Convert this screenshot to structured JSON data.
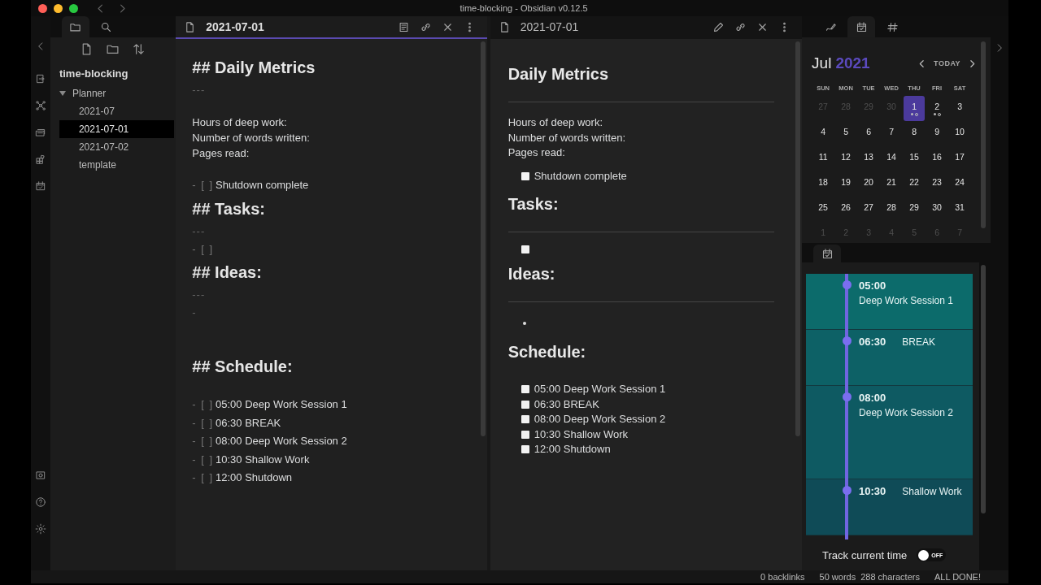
{
  "window": {
    "title": "time-blocking - Obsidian v0.12.5"
  },
  "sidebar": {
    "vault": "time-blocking",
    "tree": [
      {
        "label": "Planner",
        "expanded": true,
        "selected": false,
        "children": [
          {
            "label": "2021-07",
            "selected": false
          },
          {
            "label": "2021-07-01",
            "selected": true
          },
          {
            "label": "2021-07-02",
            "selected": false
          },
          {
            "label": "template",
            "selected": false
          }
        ]
      }
    ]
  },
  "editor": {
    "title": "2021-07-01",
    "active": true,
    "lines": [
      {
        "kind": "heading",
        "text": "## Daily Metrics"
      },
      {
        "kind": "rule",
        "text": "---"
      },
      {
        "kind": "gap"
      },
      {
        "kind": "text",
        "text": "Hours of deep work:"
      },
      {
        "kind": "text",
        "text": "Number of words written:"
      },
      {
        "kind": "text",
        "text": "Pages read:"
      },
      {
        "kind": "gap"
      },
      {
        "kind": "task",
        "marker": "- [ ]",
        "text": "Shutdown complete"
      },
      {
        "kind": "heading",
        "text": "## Tasks:"
      },
      {
        "kind": "rule",
        "text": "---"
      },
      {
        "kind": "task",
        "marker": "- [ ]"
      },
      {
        "kind": "heading",
        "text": "## Ideas:"
      },
      {
        "kind": "rule",
        "text": "---"
      },
      {
        "kind": "rule",
        "text": "-"
      },
      {
        "kind": "gap"
      },
      {
        "kind": "gap"
      },
      {
        "kind": "heading",
        "text": "## Schedule:"
      },
      {
        "kind": "gap"
      },
      {
        "kind": "task",
        "marker": "- [ ]",
        "text": "05:00 Deep Work Session 1"
      },
      {
        "kind": "task",
        "marker": "- [ ]",
        "text": "06:30 BREAK"
      },
      {
        "kind": "task",
        "marker": "- [ ]",
        "text": "08:00 Deep Work Session 2"
      },
      {
        "kind": "task",
        "marker": "- [ ]",
        "text": "10:30 Shallow Work"
      },
      {
        "kind": "task",
        "marker": "- [ ]",
        "text": "12:00 Shutdown"
      }
    ]
  },
  "preview": {
    "title": "2021-07-01",
    "active": false,
    "blocks": [
      {
        "kind": "heading",
        "text": "Daily Metrics"
      },
      {
        "kind": "rule"
      },
      {
        "kind": "text",
        "text": "Hours of deep work:"
      },
      {
        "kind": "text",
        "text": "Number of words written:"
      },
      {
        "kind": "text",
        "text": "Pages read:"
      },
      {
        "kind": "task",
        "checked": false,
        "text": "Shutdown complete"
      },
      {
        "kind": "heading",
        "text": "Tasks:"
      },
      {
        "kind": "rule"
      },
      {
        "kind": "task",
        "checked": false
      },
      {
        "kind": "heading",
        "text": "Ideas:"
      },
      {
        "kind": "rule"
      },
      {
        "kind": "bullet"
      },
      {
        "kind": "heading",
        "text": "Schedule:"
      },
      {
        "kind": "task",
        "checked": false,
        "text": "05:00 Deep Work Session 1"
      },
      {
        "kind": "task",
        "checked": false,
        "text": "06:30 BREAK"
      },
      {
        "kind": "task",
        "checked": false,
        "text": "08:00 Deep Work Session 2"
      },
      {
        "kind": "task",
        "checked": false,
        "text": "10:30 Shallow Work"
      },
      {
        "kind": "task",
        "checked": false,
        "text": "12:00 Shutdown"
      }
    ]
  },
  "calendar": {
    "month": "Jul",
    "year": "2021",
    "today": "TODAY",
    "weekdays": [
      "SUN",
      "MON",
      "TUE",
      "WED",
      "THU",
      "FRI",
      "SAT"
    ],
    "weeks": [
      [
        {
          "day": "27",
          "muted": true,
          "selected": false,
          "note": false,
          "tasks": false
        },
        {
          "day": "28",
          "muted": true,
          "selected": false,
          "note": false,
          "tasks": false
        },
        {
          "day": "29",
          "muted": true,
          "selected": false,
          "note": false,
          "tasks": false
        },
        {
          "day": "30",
          "muted": true,
          "selected": false,
          "note": false,
          "tasks": false
        },
        {
          "day": "1",
          "muted": false,
          "selected": true,
          "note": true,
          "tasks": true
        },
        {
          "day": "2",
          "muted": false,
          "selected": false,
          "note": true,
          "tasks": true
        },
        {
          "day": "3",
          "muted": false,
          "selected": false,
          "note": false,
          "tasks": false
        }
      ],
      [
        {
          "day": "4",
          "muted": false,
          "selected": false,
          "note": false,
          "tasks": false
        },
        {
          "day": "5",
          "muted": false,
          "selected": false,
          "note": false,
          "tasks": false
        },
        {
          "day": "6",
          "muted": false,
          "selected": false,
          "note": false,
          "tasks": false
        },
        {
          "day": "7",
          "muted": false,
          "selected": false,
          "note": false,
          "tasks": false
        },
        {
          "day": "8",
          "muted": false,
          "selected": false,
          "note": false,
          "tasks": false
        },
        {
          "day": "9",
          "muted": false,
          "selected": false,
          "note": false,
          "tasks": false
        },
        {
          "day": "10",
          "muted": false,
          "selected": false,
          "note": false,
          "tasks": false
        }
      ],
      [
        {
          "day": "11",
          "muted": false,
          "selected": false,
          "note": false,
          "tasks": false
        },
        {
          "day": "12",
          "muted": false,
          "selected": false,
          "note": false,
          "tasks": false
        },
        {
          "day": "13",
          "muted": false,
          "selected": false,
          "note": false,
          "tasks": false
        },
        {
          "day": "14",
          "muted": false,
          "selected": false,
          "note": false,
          "tasks": false
        },
        {
          "day": "15",
          "muted": false,
          "selected": false,
          "note": false,
          "tasks": false
        },
        {
          "day": "16",
          "muted": false,
          "selected": false,
          "note": false,
          "tasks": false
        },
        {
          "day": "17",
          "muted": false,
          "selected": false,
          "note": false,
          "tasks": false
        }
      ],
      [
        {
          "day": "18",
          "muted": false,
          "selected": false,
          "note": false,
          "tasks": false
        },
        {
          "day": "19",
          "muted": false,
          "selected": false,
          "note": false,
          "tasks": false
        },
        {
          "day": "20",
          "muted": false,
          "selected": false,
          "note": false,
          "tasks": false
        },
        {
          "day": "21",
          "muted": false,
          "selected": false,
          "note": false,
          "tasks": false
        },
        {
          "day": "22",
          "muted": false,
          "selected": false,
          "note": false,
          "tasks": false
        },
        {
          "day": "23",
          "muted": false,
          "selected": false,
          "note": false,
          "tasks": false
        },
        {
          "day": "24",
          "muted": false,
          "selected": false,
          "note": false,
          "tasks": false
        }
      ],
      [
        {
          "day": "25",
          "muted": false,
          "selected": false,
          "note": false,
          "tasks": false
        },
        {
          "day": "26",
          "muted": false,
          "selected": false,
          "note": false,
          "tasks": false
        },
        {
          "day": "27",
          "muted": false,
          "selected": false,
          "note": false,
          "tasks": false
        },
        {
          "day": "28",
          "muted": false,
          "selected": false,
          "note": false,
          "tasks": false
        },
        {
          "day": "29",
          "muted": false,
          "selected": false,
          "note": false,
          "tasks": false
        },
        {
          "day": "30",
          "muted": false,
          "selected": false,
          "note": false,
          "tasks": false
        },
        {
          "day": "31",
          "muted": false,
          "selected": false,
          "note": false,
          "tasks": false
        }
      ],
      [
        {
          "day": "1",
          "muted": true,
          "selected": false,
          "note": false,
          "tasks": false
        },
        {
          "day": "2",
          "muted": true,
          "selected": false,
          "note": false,
          "tasks": false
        },
        {
          "day": "3",
          "muted": true,
          "selected": false,
          "note": false,
          "tasks": false
        },
        {
          "day": "4",
          "muted": true,
          "selected": false,
          "note": false,
          "tasks": false
        },
        {
          "day": "5",
          "muted": true,
          "selected": false,
          "note": false,
          "tasks": false
        },
        {
          "day": "6",
          "muted": true,
          "selected": false,
          "note": false,
          "tasks": false
        },
        {
          "day": "7",
          "muted": true,
          "selected": false,
          "note": false,
          "tasks": false
        }
      ]
    ]
  },
  "timeline": {
    "blocks": [
      {
        "time": "05:00",
        "title": "Deep Work Session 1",
        "kind": "stacked",
        "color": "#0c6b6b"
      },
      {
        "time": "06:30",
        "title": "BREAK",
        "kind": "inline",
        "color": "#0d6166"
      },
      {
        "time": "08:00",
        "title": "Deep Work Session 2",
        "kind": "long",
        "color": "#0e5a62"
      },
      {
        "time": "10:30",
        "title": "Shallow Work",
        "kind": "inline",
        "color": "#0f4b57"
      }
    ],
    "tracker": {
      "label": "Track current time",
      "on": false,
      "state_label": "OFF"
    }
  },
  "status_bar": [
    "0 backlinks",
    "50 words",
    "288 characters",
    "ALL DONE!"
  ]
}
